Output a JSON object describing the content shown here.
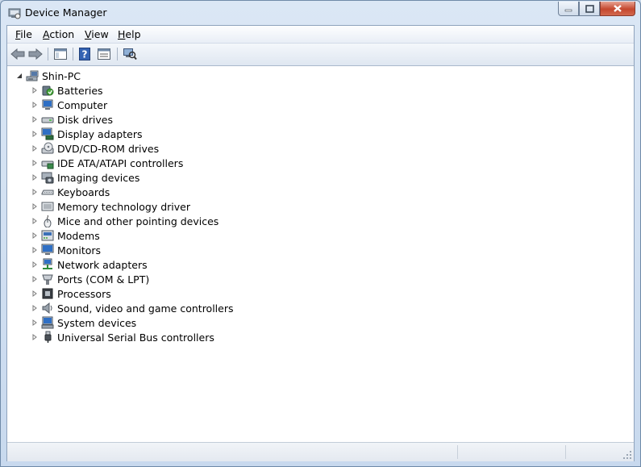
{
  "window": {
    "title": "Device Manager"
  },
  "menu": {
    "items": [
      {
        "label": "File",
        "accel": "F",
        "rest": "ile"
      },
      {
        "label": "Action",
        "accel": "A",
        "rest": "ction"
      },
      {
        "label": "View",
        "accel": "V",
        "rest": "iew"
      },
      {
        "label": "Help",
        "accel": "H",
        "rest": "elp"
      }
    ]
  },
  "toolbar": {
    "buttons": [
      "back-icon",
      "forward-icon",
      "show-hide-console-tree-icon",
      "help-icon",
      "properties-icon",
      "scan-hardware-changes-icon"
    ]
  },
  "tree": {
    "root": {
      "label": "Shin-PC",
      "expanded": true
    },
    "categories": [
      {
        "label": "Batteries",
        "icon": "battery-icon"
      },
      {
        "label": "Computer",
        "icon": "computer-icon"
      },
      {
        "label": "Disk drives",
        "icon": "disk-drive-icon"
      },
      {
        "label": "Display adapters",
        "icon": "display-adapter-icon"
      },
      {
        "label": "DVD/CD-ROM drives",
        "icon": "dvd-drive-icon"
      },
      {
        "label": "IDE ATA/ATAPI controllers",
        "icon": "ide-controller-icon"
      },
      {
        "label": "Imaging devices",
        "icon": "camera-icon"
      },
      {
        "label": "Keyboards",
        "icon": "keyboard-icon"
      },
      {
        "label": "Memory technology driver",
        "icon": "memory-icon"
      },
      {
        "label": "Mice and other pointing devices",
        "icon": "mouse-icon"
      },
      {
        "label": "Modems",
        "icon": "modem-icon"
      },
      {
        "label": "Monitors",
        "icon": "monitor-icon"
      },
      {
        "label": "Network adapters",
        "icon": "network-adapter-icon"
      },
      {
        "label": "Ports (COM & LPT)",
        "icon": "port-icon"
      },
      {
        "label": "Processors",
        "icon": "processor-icon"
      },
      {
        "label": "Sound, video and game controllers",
        "icon": "speaker-icon"
      },
      {
        "label": "System devices",
        "icon": "system-device-icon"
      },
      {
        "label": "Universal Serial Bus controllers",
        "icon": "usb-icon"
      }
    ]
  },
  "colors": {
    "accent": "#3d6fb4",
    "close": "#c4472e"
  }
}
